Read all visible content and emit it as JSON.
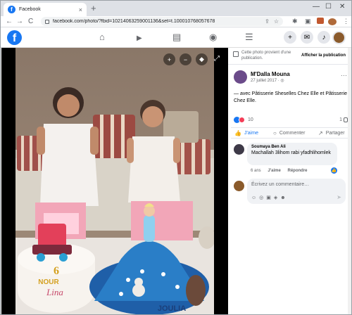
{
  "browser": {
    "tab_title": "Facebook",
    "tab_close": "×",
    "new_tab": "+",
    "win_min": "—",
    "win_max": "☐",
    "win_close": "✕",
    "back": "←",
    "forward": "→",
    "reload": "C",
    "url": "facebook.com/photo/?fbid=1021406325900113​6&set=t.100010768057678",
    "share_glyph": "⇪",
    "star_glyph": "☆",
    "ext_glyph": "✱",
    "sidepanel_glyph": "▣",
    "menu_glyph": "⋮"
  },
  "fbnav": {
    "logo": "f",
    "home": "⌂",
    "watch": "▶",
    "marketplace": "▤",
    "groups": "◉",
    "menu": "☰",
    "create": "+",
    "messenger": "✉",
    "notifications": "♪"
  },
  "photo": {
    "zoom_in": "+",
    "zoom_out": "−",
    "tag": "◆",
    "fullscreen": "⤢",
    "cake_text_1": "6",
    "cake_text_2": "NOUR",
    "cake_text_3": "Lina",
    "cake_text_4": "JOULIA"
  },
  "side": {
    "notice_text": "Cette photo provient d'une publication.",
    "notice_link": "Afficher la publication",
    "author": "M'Dalla Mouna",
    "date": "27 juillet 2017 · ◎",
    "more": "···",
    "caption": "— avec Pâtisserie Sheselles Chez Elle et Pâtisserie Chez Elle.",
    "reaction_count": "10",
    "comment_count": "1",
    "action_like": "J'aime",
    "action_comment": "Commenter",
    "action_share": "Partager",
    "like_glyph": "👍",
    "comment_glyph": "○",
    "share_glyph": "↗"
  },
  "comment": {
    "name": "Soumaya Ben Ali",
    "text": "Machallah 3lihom rabi yfadhlihomlek",
    "age": "6 ans",
    "like": "J'aime",
    "reply": "Répondre",
    "react_glyph": "👍"
  },
  "write": {
    "placeholder": "Écrivez un commentaire…",
    "icons": "☺◎▣◈☻",
    "send": "➤"
  },
  "colors": {
    "facebook_blue": "#1877f2",
    "love_red": "#f33e58"
  }
}
